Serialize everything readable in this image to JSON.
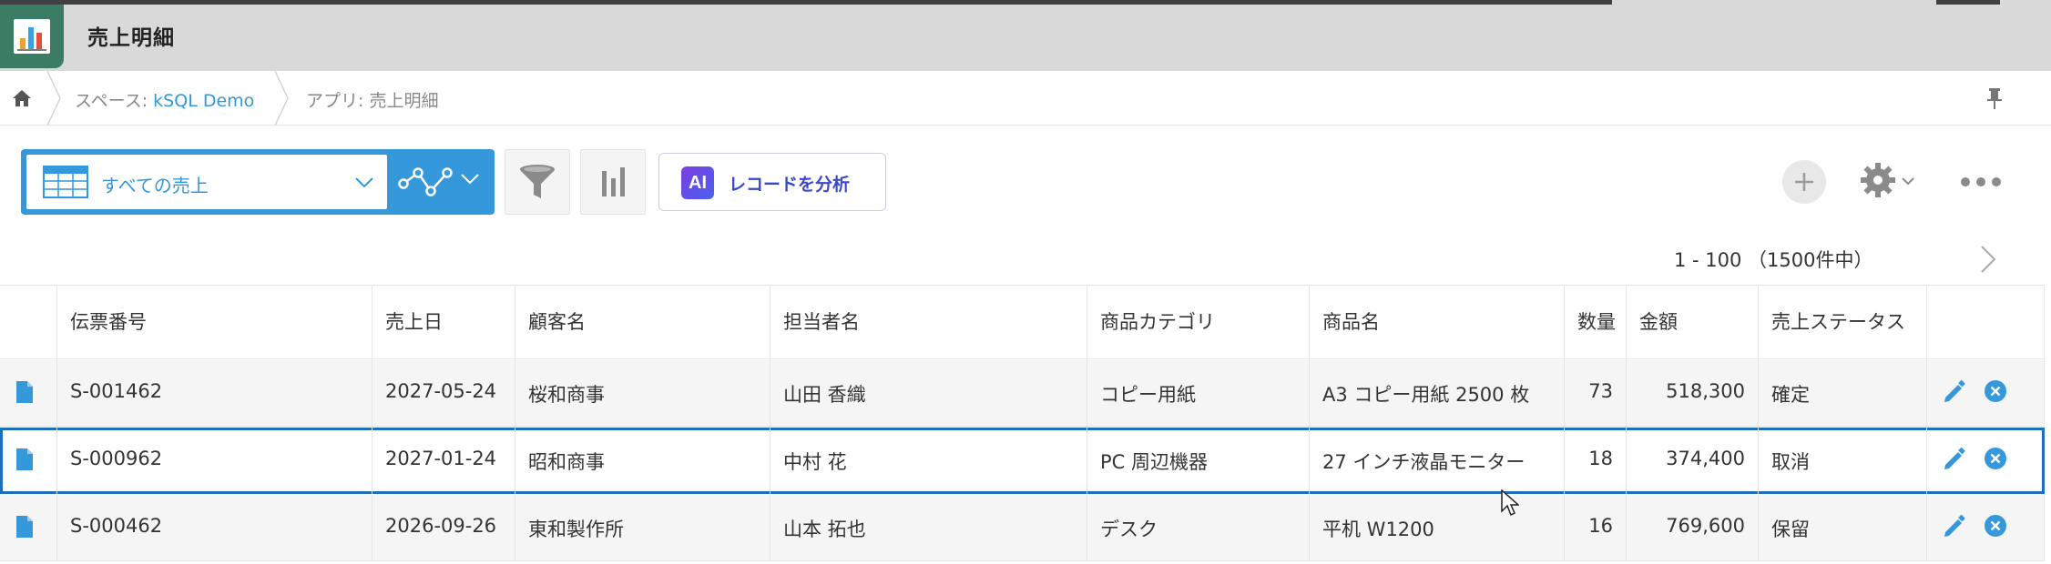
{
  "app": {
    "title": "売上明細",
    "icon": "app-bar-chart-icon"
  },
  "breadcrumb": {
    "space_prefix": "スペース: ",
    "space_name": "kSQL Demo",
    "app_prefix": "アプリ: ",
    "app_name": "売上明細"
  },
  "toolbar": {
    "view_label": "すべての売上",
    "ai_badge": "AI",
    "ai_button_label": "レコードを分析"
  },
  "pager": {
    "range_text": "1 - 100 （1500件中）"
  },
  "table": {
    "headers": [
      "伝票番号",
      "売上日",
      "顧客名",
      "担当者名",
      "商品カテゴリ",
      "商品名",
      "数量",
      "金額",
      "売上ステータス"
    ],
    "rows": [
      {
        "id": "S-001462",
        "date": "2027-05-24",
        "customer": "桜和商事",
        "rep": "山田 香織",
        "category": "コピー用紙",
        "product": "A3 コピー用紙 2500 枚",
        "qty": "73",
        "amount": "518,300",
        "status": "確定"
      },
      {
        "id": "S-000962",
        "date": "2027-01-24",
        "customer": "昭和商事",
        "rep": "中村 花",
        "category": "PC 周辺機器",
        "product": "27 インチ液晶モニター",
        "qty": "18",
        "amount": "374,400",
        "status": "取消"
      },
      {
        "id": "S-000462",
        "date": "2026-09-26",
        "customer": "東和製作所",
        "rep": "山本 拓也",
        "category": "デスク",
        "product": "平机 W1200",
        "qty": "16",
        "amount": "769,600",
        "status": "保留"
      }
    ]
  },
  "colors": {
    "accent": "#3498db",
    "selection": "#1d6fb8",
    "app_icon_bg": "#3a7d64"
  }
}
